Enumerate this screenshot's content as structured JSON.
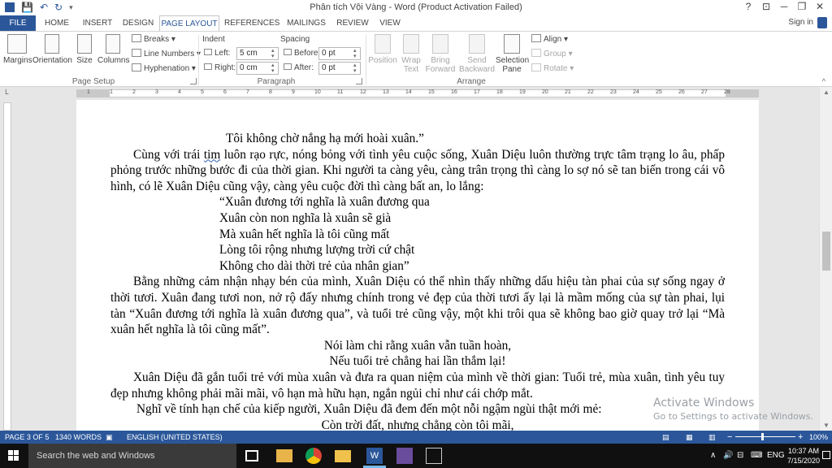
{
  "window": {
    "title": "Phân tích Vội Vàng - Word (Product Activation Failed)",
    "help_glyph": "?",
    "restore_ribbon_glyph": "⊡",
    "minimize_glyph": "─",
    "maximize_glyph": "❐",
    "close_glyph": "✕"
  },
  "qat": {
    "save_glyph": "💾",
    "undo_glyph": "↶",
    "redo_glyph": "↻",
    "customize_glyph": "▾"
  },
  "tabs": [
    {
      "label": "FILE"
    },
    {
      "label": "HOME"
    },
    {
      "label": "INSERT"
    },
    {
      "label": "DESIGN"
    },
    {
      "label": "PAGE LAYOUT"
    },
    {
      "label": "REFERENCES"
    },
    {
      "label": "MAILINGS"
    },
    {
      "label": "REVIEW"
    },
    {
      "label": "VIEW"
    }
  ],
  "signin": "Sign in",
  "ribbon": {
    "page_setup": {
      "label": "Page Setup",
      "margins": "Margins",
      "orientation": "Orientation",
      "size": "Size",
      "columns": "Columns",
      "breaks": "Breaks",
      "line_numbers": "Line Numbers",
      "hyphenation": "Hyphenation"
    },
    "paragraph": {
      "label": "Paragraph",
      "indent_header": "Indent",
      "spacing_header": "Spacing",
      "left_label": "Left:",
      "left_value": "5 cm",
      "right_label": "Right:",
      "right_value": "0 cm",
      "before_label": "Before:",
      "before_value": "0 pt",
      "after_label": "After:",
      "after_value": "0 pt"
    },
    "arrange": {
      "label": "Arrange",
      "position": "Position",
      "wrap_text_1": "Wrap",
      "wrap_text_2": "Text",
      "bring_forward_1": "Bring",
      "bring_forward_2": "Forward",
      "send_backward_1": "Send",
      "send_backward_2": "Backward",
      "selection_pane_1": "Selection",
      "selection_pane_2": "Pane",
      "align": "Align",
      "group": "Group",
      "rotate": "Rotate"
    }
  },
  "ruler_numbers": [
    "1",
    "1",
    "2",
    "3",
    "4",
    "5",
    "6",
    "7",
    "8",
    "9",
    "10",
    "11",
    "12",
    "13",
    "14",
    "15",
    "16",
    "17",
    "18",
    "19",
    "20",
    "21",
    "22",
    "23",
    "24",
    "25",
    "26",
    "27",
    "28"
  ],
  "document": {
    "line_0": "Tôi không chờ nắng hạ mới hoài xuân.”",
    "p1_a": "Cùng với trái ",
    "p1_word": "tim",
    "p1_b": " luôn rạo rực, nóng bỏng với tình yêu cuộc sống, Xuân Diệu luôn thường trực tâm trạng lo âu, phấp phỏng trước những bước đi của thời gian. Khi người ta càng yêu, càng trân trọng thì càng lo sợ nó sẽ tan biến trong cái vô hình, có lẽ Xuân Diệu cũng vậy, càng yêu cuộc đời thì càng bất an, lo lắng:",
    "verse1": [
      "“Xuân đương tới nghĩa là xuân đương qua",
      "Xuân còn non nghĩa là xuân sẽ già",
      "Mà xuân hết nghĩa là tôi cũng mất",
      "Lòng tôi rộng nhưng lượng trời cứ chật",
      "Không cho dài thời trẻ của nhân gian”"
    ],
    "p2": "Bằng những cảm nhận nhạy bén của mình, Xuân Diệu có thể nhìn thấy những dấu hiệu tàn phai của sự sống ngay ở thời tươi. Xuân đang tươi non, nở rộ đấy nhưng chính trong vẻ đẹp của thời tươi ấy lại là mầm mống của sự tàn phai, lụi tàn “Xuân đương tới nghĩa là xuân đương qua”, và tuổi trẻ cũng vậy, một khi trôi qua sẽ không bao giờ quay trở lại “Mà xuân hết nghĩa là tôi cũng mất”.",
    "verse2": [
      "Nói làm chi rằng xuân vẫn tuần hoàn,",
      "Nếu tuổi trẻ chẳng hai lần thắm lại!"
    ],
    "p3": "Xuân Diệu đã gắn tuổi trẻ với mùa xuân và đưa ra quan niệm của mình về thời gian: Tuổi trẻ, mùa xuân, tình yêu tuy đẹp nhưng không phải mãi mãi, vô hạn mà hữu hạn, ngắn ngủi chỉ như cái chớp mắt.",
    "p4": "Nghĩ về tính hạn chế của kiếp người, Xuân Diệu đã đem đến một nỗi ngậm ngùi thật mới mẻ:",
    "verse3": "Còn trời đất, nhưng chẳng còn tôi mãi,"
  },
  "watermark": {
    "line1": "Activate Windows",
    "line2": "Go to Settings to activate Windows."
  },
  "status": {
    "page": "PAGE 3 OF 5",
    "words": "1340 WORDS",
    "language": "ENGLISH (UNITED STATES)",
    "zoom_minus": "−",
    "zoom_plus": "+",
    "zoom": "100%"
  },
  "taskbar": {
    "search_placeholder": "Search the web and Windows",
    "language": "ENG",
    "time": "10:37 AM",
    "date": "7/15/2020",
    "tray_up_glyph": "∧",
    "volume_glyph": "🔊",
    "network_glyph": "⊟"
  },
  "colors": {
    "word_blue": "#2b579a",
    "taskbar": "#101010"
  }
}
